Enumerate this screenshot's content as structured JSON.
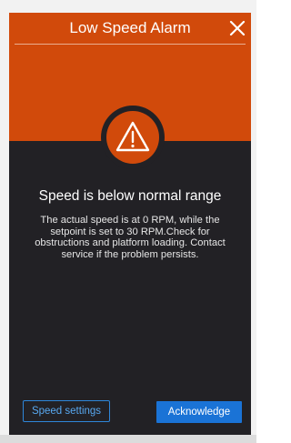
{
  "dialog": {
    "title": "Low Speed Alarm",
    "headline": "Speed is below normal range",
    "message": "The actual speed is at 0 RPM, while the setpoint is set to 30 RPM.Check for obstructions and platform loading. Contact service if the problem persists.",
    "buttons": {
      "settings_label": "Speed settings",
      "acknowledge_label": "Acknowledge"
    },
    "icons": {
      "close": "close-icon",
      "alert": "warning-triangle-icon"
    }
  },
  "colors": {
    "accent_orange": "#d14a0b",
    "panel_dark": "#222125",
    "primary_blue": "#1a73d6",
    "link_blue": "#58a8f0"
  }
}
